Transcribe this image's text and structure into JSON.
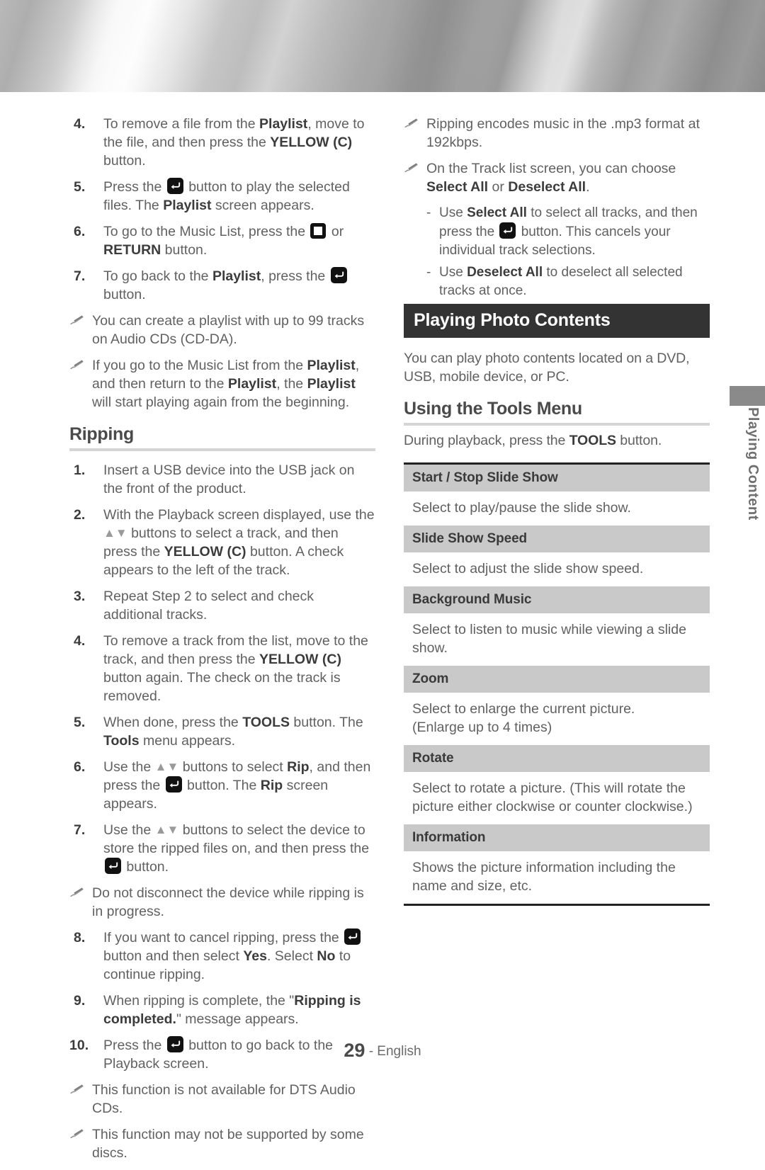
{
  "page": {
    "number": "29",
    "footer_separator": "-",
    "language": "English",
    "side_tab_label": "Playing Content"
  },
  "icons": {
    "enter_button": "enter-button-icon",
    "stop_button": "stop-button-icon",
    "up_down_buttons": "up-down-arrows-icon",
    "note_bullet": "pencil-note-icon"
  },
  "left_column": {
    "steps_playlist": [
      {
        "num": "4.",
        "parts": [
          {
            "t": "To remove a file from the "
          },
          {
            "b": "Playlist"
          },
          {
            "t": ", move to the file, and then press the "
          },
          {
            "b": "YELLOW (C)"
          },
          {
            "t": " button."
          }
        ]
      },
      {
        "num": "5.",
        "parts": [
          {
            "t": "Press the "
          },
          {
            "icon": "enter"
          },
          {
            "t": " button to play the selected files. The "
          },
          {
            "b": "Playlist"
          },
          {
            "t": " screen appears."
          }
        ]
      },
      {
        "num": "6.",
        "parts": [
          {
            "t": "To go to the Music List, press the "
          },
          {
            "icon": "stop"
          },
          {
            "t": " or "
          },
          {
            "b": "RETURN"
          },
          {
            "t": " button."
          }
        ]
      },
      {
        "num": "7.",
        "parts": [
          {
            "t": "To go back to the "
          },
          {
            "b": "Playlist"
          },
          {
            "t": ", press the "
          },
          {
            "icon": "enter"
          },
          {
            "t": " button."
          }
        ]
      }
    ],
    "notes_playlist": [
      {
        "parts": [
          {
            "t": "You can create a playlist with up to 99 tracks on Audio CDs (CD-DA)."
          }
        ]
      },
      {
        "parts": [
          {
            "t": "If you go to the Music List from the "
          },
          {
            "b": "Playlist"
          },
          {
            "t": ", and then return to the "
          },
          {
            "b": "Playlist"
          },
          {
            "t": ", the "
          },
          {
            "b": "Playlist"
          },
          {
            "t": " will start playing again from the beginning."
          }
        ]
      }
    ],
    "ripping_heading": "Ripping",
    "steps_ripping_a": [
      {
        "num": "1.",
        "parts": [
          {
            "t": "Insert a USB device into the USB jack on the front of the product."
          }
        ]
      },
      {
        "num": "2.",
        "parts": [
          {
            "t": "With the Playback screen displayed, use the "
          },
          {
            "icon": "arrows"
          },
          {
            "t": " buttons to select a track, and then press the "
          },
          {
            "b": "YELLOW (C)"
          },
          {
            "t": " button. A check appears to the left of the track."
          }
        ]
      },
      {
        "num": "3.",
        "parts": [
          {
            "t": "Repeat Step 2 to select and check additional tracks."
          }
        ]
      },
      {
        "num": "4.",
        "parts": [
          {
            "t": "To remove a track from the list, move to the track, and then press the "
          },
          {
            "b": "YELLOW (C)"
          },
          {
            "t": " button again. The check on the track is removed."
          }
        ]
      },
      {
        "num": "5.",
        "parts": [
          {
            "t": "When done, press the "
          },
          {
            "b": "TOOLS"
          },
          {
            "t": " button. The "
          },
          {
            "b": "Tools"
          },
          {
            "t": " menu appears."
          }
        ]
      },
      {
        "num": "6.",
        "parts": [
          {
            "t": "Use the "
          },
          {
            "icon": "arrows"
          },
          {
            "t": " buttons to select "
          },
          {
            "b": "Rip"
          },
          {
            "t": ", and then press the "
          },
          {
            "icon": "enter"
          },
          {
            "t": " button. The "
          },
          {
            "b": "Rip"
          },
          {
            "t": " screen appears."
          }
        ]
      },
      {
        "num": "7.",
        "parts": [
          {
            "t": "Use the "
          },
          {
            "icon": "arrows"
          },
          {
            "t": " buttons to select the device to store the ripped files on, and then press the "
          },
          {
            "icon": "enter"
          },
          {
            "t": " button."
          }
        ]
      }
    ],
    "note_ripping_mid": {
      "parts": [
        {
          "t": "Do not disconnect the device while ripping is in progress."
        }
      ]
    },
    "steps_ripping_b": [
      {
        "num": "8.",
        "parts": [
          {
            "t": "If you want to cancel ripping, press the "
          },
          {
            "icon": "enter"
          },
          {
            "t": " button and then select "
          },
          {
            "b": "Yes"
          },
          {
            "t": ". Select "
          },
          {
            "b": "No"
          },
          {
            "t": " to continue ripping."
          }
        ]
      },
      {
        "num": "9.",
        "parts": [
          {
            "t": "When ripping is complete, the \""
          },
          {
            "b": "Ripping is completed."
          },
          {
            "t": "\" message appears."
          }
        ]
      },
      {
        "num": "10.",
        "parts": [
          {
            "t": "Press the "
          },
          {
            "icon": "enter"
          },
          {
            "t": " button to go back to the Playback screen."
          }
        ]
      }
    ],
    "notes_ripping_end": [
      {
        "parts": [
          {
            "t": "This function is not available for DTS Audio CDs."
          }
        ]
      },
      {
        "parts": [
          {
            "t": "This function may not be supported by some discs."
          }
        ]
      }
    ]
  },
  "right_column": {
    "notes_top": [
      {
        "parts": [
          {
            "t": "Ripping encodes music in the .mp3 format at 192kbps."
          }
        ]
      },
      {
        "parts": [
          {
            "t": "On the Track list screen, you can choose "
          },
          {
            "b": "Select All"
          },
          {
            "t": " or "
          },
          {
            "b": "Deselect All"
          },
          {
            "t": "."
          }
        ]
      }
    ],
    "dash_items": [
      {
        "mark": "-",
        "parts": [
          {
            "t": "Use "
          },
          {
            "b": "Select All"
          },
          {
            "t": " to select all tracks, and then press the "
          },
          {
            "icon": "enter"
          },
          {
            "t": " button. This cancels your individual track selections."
          }
        ]
      },
      {
        "mark": "-",
        "parts": [
          {
            "t": "Use "
          },
          {
            "b": "Deselect All"
          },
          {
            "t": " to deselect all selected tracks at once."
          }
        ]
      }
    ],
    "section_title": "Playing Photo Contents",
    "section_intro": "You can play photo contents located on a DVD, USB, mobile device, or PC.",
    "tools_heading": "Using the Tools Menu",
    "tools_intro_parts": [
      {
        "t": "During playback, press the "
      },
      {
        "b": "TOOLS"
      },
      {
        "t": " button."
      }
    ],
    "tools_table": [
      {
        "header": "Start / Stop Slide Show",
        "body": "Select to play/pause the slide show."
      },
      {
        "header": "Slide Show Speed",
        "body": "Select to adjust the slide show speed."
      },
      {
        "header": "Background Music",
        "body": "Select to listen to music while viewing a slide show."
      },
      {
        "header": "Zoom",
        "body": "Select to enlarge the current picture.\n(Enlarge up to 4 times)"
      },
      {
        "header": "Rotate",
        "body": "Select to rotate a picture. (This will rotate the picture either clockwise or counter clockwise.)"
      },
      {
        "header": "Information",
        "body": "Shows the picture information including the name and size, etc."
      }
    ]
  }
}
